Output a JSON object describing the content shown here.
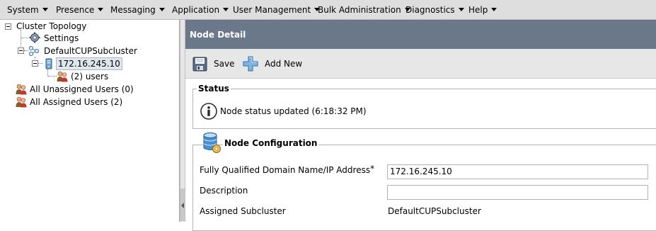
{
  "menubar": {
    "items": [
      {
        "label": "System"
      },
      {
        "label": "Presence"
      },
      {
        "label": "Messaging"
      },
      {
        "label": "Application"
      },
      {
        "label": "User Management"
      },
      {
        "label": "Bulk Administration"
      },
      {
        "label": "Diagnostics"
      },
      {
        "label": "Help"
      }
    ]
  },
  "tree": {
    "root": "Cluster Topology",
    "settings": "Settings",
    "subcluster": "DefaultCUPSubcluster",
    "node": "172.16.245.10",
    "node_users": "(2) users",
    "unassigned": "All Unassigned Users (0)",
    "assigned": "All Assigned Users (2)"
  },
  "page": {
    "title": "Node Detail",
    "toolbar": {
      "save_label": "Save",
      "add_new_label": "Add New"
    },
    "status": {
      "legend": "Status",
      "message": "Node status updated (6:18:32 PM)"
    },
    "node_config": {
      "legend": "Node Configuration",
      "fqdn_label": "Fully Qualified Domain Name/IP Address",
      "required_mark": "*",
      "fqdn_value": "172.16.245.10",
      "description_label": "Description",
      "description_value": "",
      "subcluster_label": "Assigned Subcluster",
      "subcluster_value": "DefaultCUPSubcluster"
    }
  },
  "colors": {
    "title_bar": "#6b7889",
    "menubar": "#dedede",
    "toolbar": "#e7e7e7"
  }
}
